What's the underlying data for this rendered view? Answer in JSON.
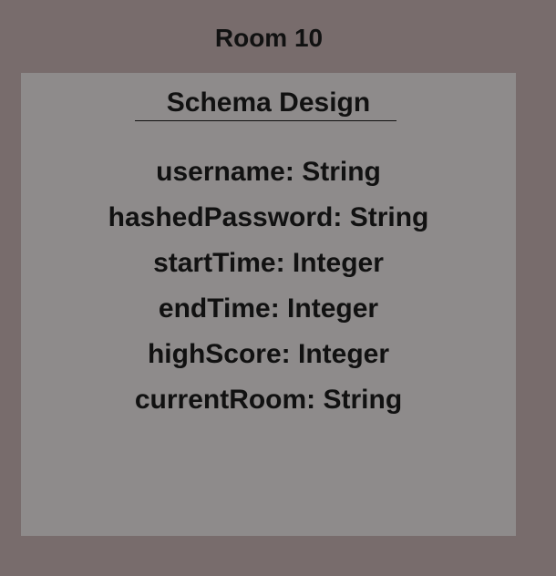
{
  "room": {
    "title": "Room 10"
  },
  "schema": {
    "heading": "Schema Design",
    "fields": [
      "username: String",
      "hashedPassword: String",
      "startTime: Integer",
      "endTime: Integer",
      "highScore: Integer",
      "currentRoom: String"
    ]
  },
  "colors": {
    "background": "#786c6c",
    "panel": "#8e8b8b",
    "text": "#111111"
  }
}
